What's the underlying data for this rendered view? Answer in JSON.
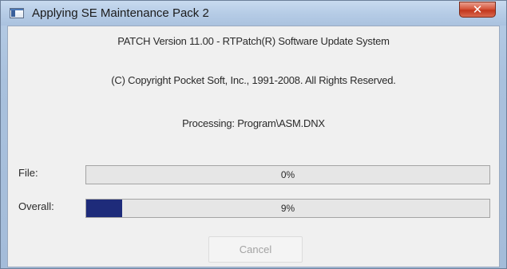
{
  "window": {
    "title": "Applying SE Maintenance Pack 2",
    "close_glyph": "✕",
    "icon": "application-icon"
  },
  "info": {
    "version_line": "PATCH  Version 11.00 - RTPatch(R) Software Update System",
    "copyright_line": "(C) Copyright Pocket Soft, Inc., 1991-2008.  All Rights Reserved.",
    "processing_line": "Processing: Program\\ASM.DNX"
  },
  "progress": {
    "file": {
      "label": "File:",
      "percent_text": "0%",
      "value": 0.0
    },
    "overall": {
      "label": "Overall:",
      "percent_text": "9%",
      "value": 0.09
    }
  },
  "buttons": {
    "cancel_label": "Cancel",
    "cancel_enabled": false
  },
  "colors": {
    "progress_fill": "#1e2b7a",
    "close_button": "#c2361c",
    "titlebar": "#b6cce6"
  }
}
